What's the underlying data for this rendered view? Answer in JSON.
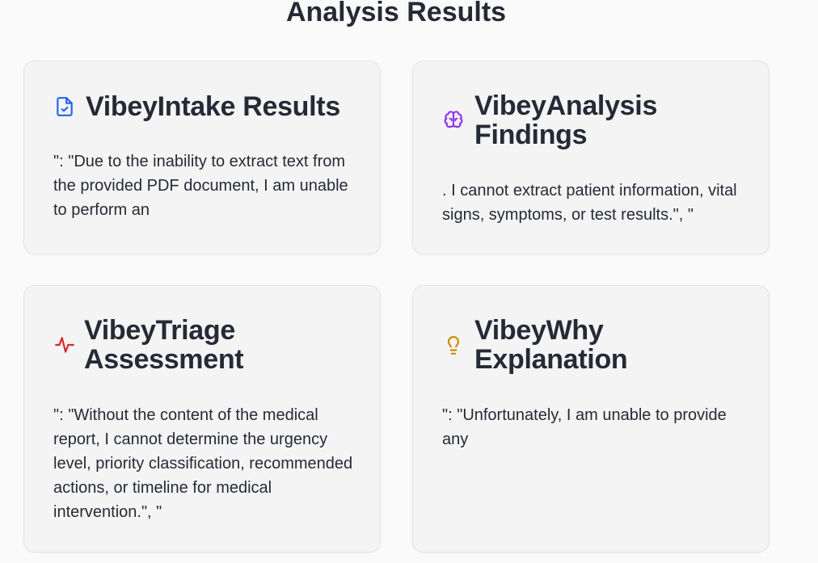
{
  "page": {
    "title": "Analysis Results"
  },
  "cards": {
    "intake": {
      "icon": "file-check-icon",
      "icon_color": "#2563eb",
      "title": "VibeyIntake Results",
      "body": "\": \"Due to the inability to extract text from the provided PDF document, I am unable to perform an"
    },
    "analysis": {
      "icon": "brain-icon",
      "icon_color": "#9333ea",
      "title": "VibeyAnalysis Findings",
      "body": ". I cannot extract patient information, vital signs, symptoms, or test results.\", \""
    },
    "triage": {
      "icon": "activity-icon",
      "icon_color": "#dc2626",
      "title": "VibeyTriage Assessment",
      "body": "\": \"Without the content of the medical report, I cannot determine the urgency level, priority classification, recommended actions, or timeline for medical intervention.\", \""
    },
    "why": {
      "icon": "lightbulb-icon",
      "icon_color": "#ca8a04",
      "title": "VibeyWhy Explanation",
      "body": "\": \"Unfortunately, I am unable to provide any"
    }
  }
}
